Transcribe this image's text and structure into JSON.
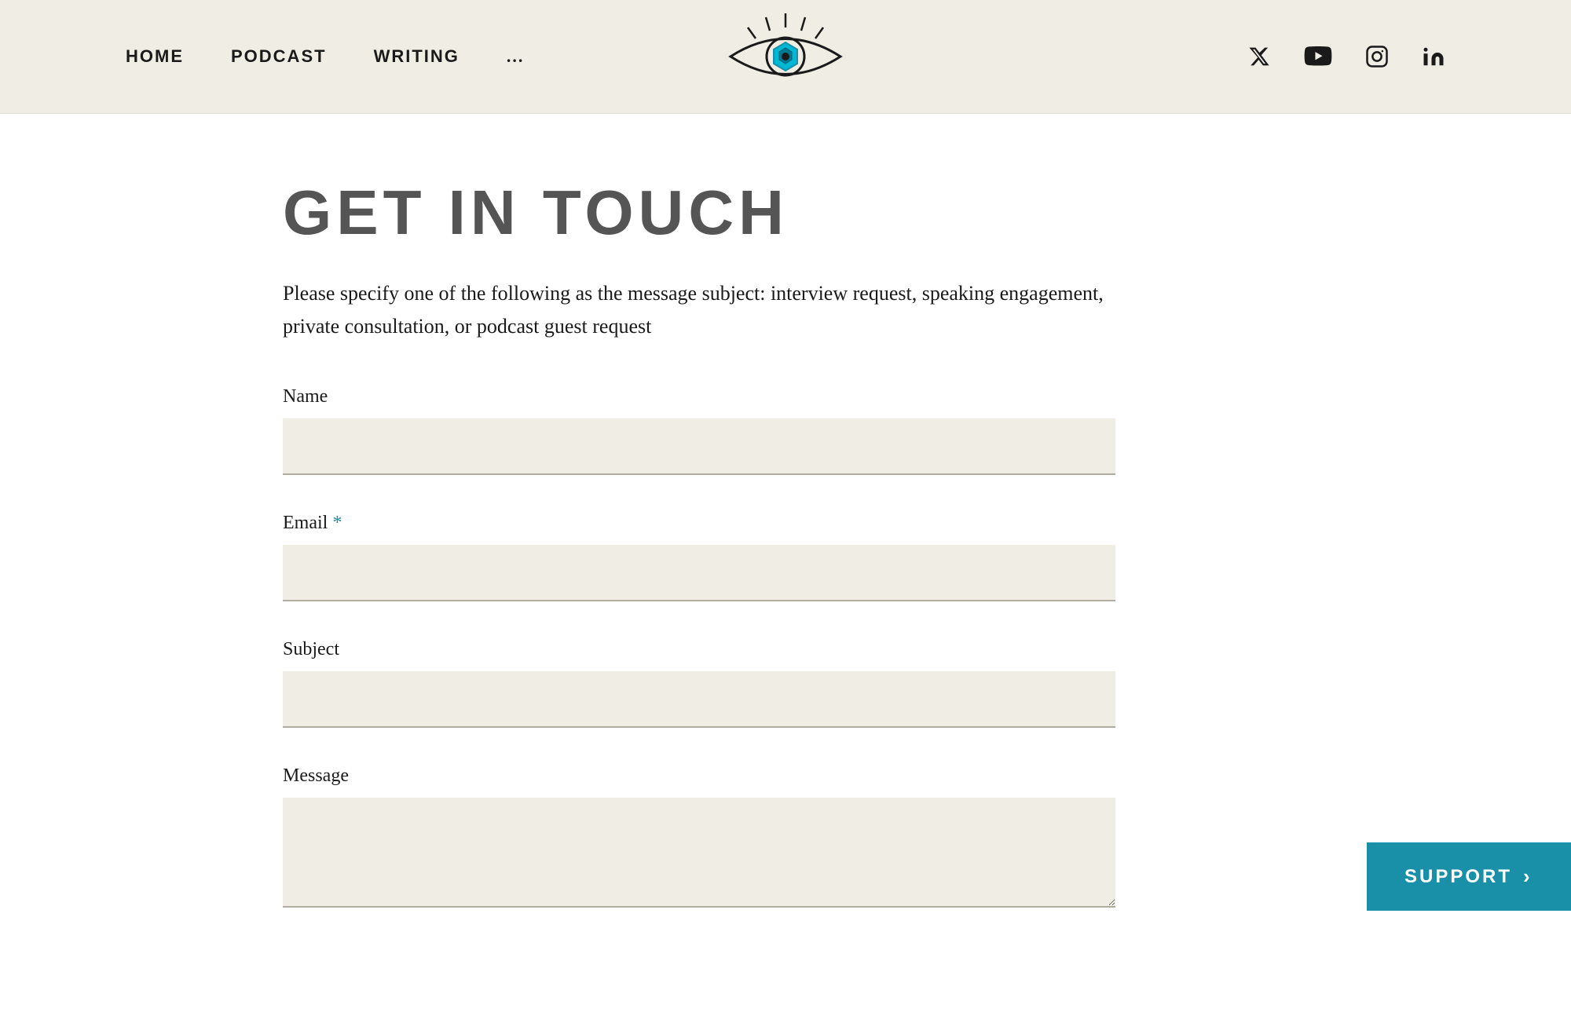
{
  "header": {
    "nav": {
      "home_label": "HOME",
      "podcast_label": "PODCAST",
      "writing_label": "WRItinG",
      "more_label": "..."
    },
    "social": {
      "twitter_label": "Twitter",
      "youtube_label": "YouTube",
      "instagram_label": "Instagram",
      "linkedin_label": "LinkedIn"
    }
  },
  "page": {
    "title": "GET IN TOUCH",
    "description": "Please specify one of the following as the message subject: interview request, speaking engagement, private consultation, or podcast guest request"
  },
  "form": {
    "name_label": "Name",
    "email_label": "Email",
    "email_required": "*",
    "subject_label": "Subject",
    "message_label": "Message"
  },
  "support": {
    "label": "SUPPORT",
    "chevron": "›"
  }
}
